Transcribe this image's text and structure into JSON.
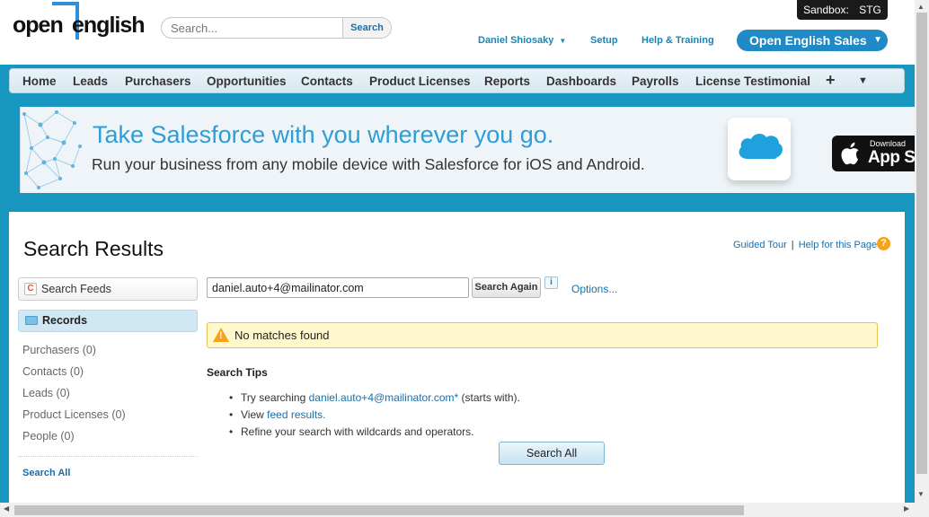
{
  "header": {
    "logo_left": "open",
    "logo_right": "english",
    "search_placeholder": "Search...",
    "search_button": "Search",
    "sandbox_label": "Sandbox:",
    "sandbox_value": "STG",
    "user_name": "Daniel Shiosaky",
    "setup": "Setup",
    "help_training": "Help & Training",
    "app_menu": "Open English Sales"
  },
  "tabs": [
    "Home",
    "Leads",
    "Purchasers",
    "Opportunities",
    "Contacts",
    "Product Licenses",
    "Reports",
    "Dashboards",
    "Payrolls",
    "License Testimonial"
  ],
  "tab_icons": {
    "plus": "plus-icon",
    "more": "chevron-down-icon"
  },
  "banner": {
    "headline": "Take Salesforce with you wherever you go.",
    "subline": "Run your business from any mobile device with Salesforce for iOS and Android.",
    "appstore_small": "Download",
    "appstore_large": "App St"
  },
  "page": {
    "title": "Search Results",
    "guided_tour": "Guided Tour",
    "separator": "|",
    "help_page": "Help for this Page",
    "help_icon": "?"
  },
  "sidebar": {
    "search_feeds": "Search Feeds",
    "records": "Records",
    "objects": [
      "Purchasers (0)",
      "Contacts (0)",
      "Leads (0)",
      "Product Licenses (0)",
      "People (0)"
    ],
    "search_all": "Search All"
  },
  "search": {
    "query": "daniel.auto+4@mailinator.com",
    "search_again": "Search Again",
    "info": "i",
    "options": "Options..."
  },
  "results": {
    "message": "No matches found",
    "tips_title": "Search Tips",
    "tip1_prefix": "Try searching ",
    "tip1_link": "daniel.auto+4@mailinator.com*",
    "tip1_suffix": " (starts with).",
    "tip2_prefix": "View ",
    "tip2_link": "feed results.",
    "tip3": "Refine your search with wildcards and operators.",
    "search_all_button": "Search All"
  },
  "colors": {
    "brand_blue": "#1797c0",
    "link": "#1a6fa8",
    "warning": "#f7a21b"
  }
}
